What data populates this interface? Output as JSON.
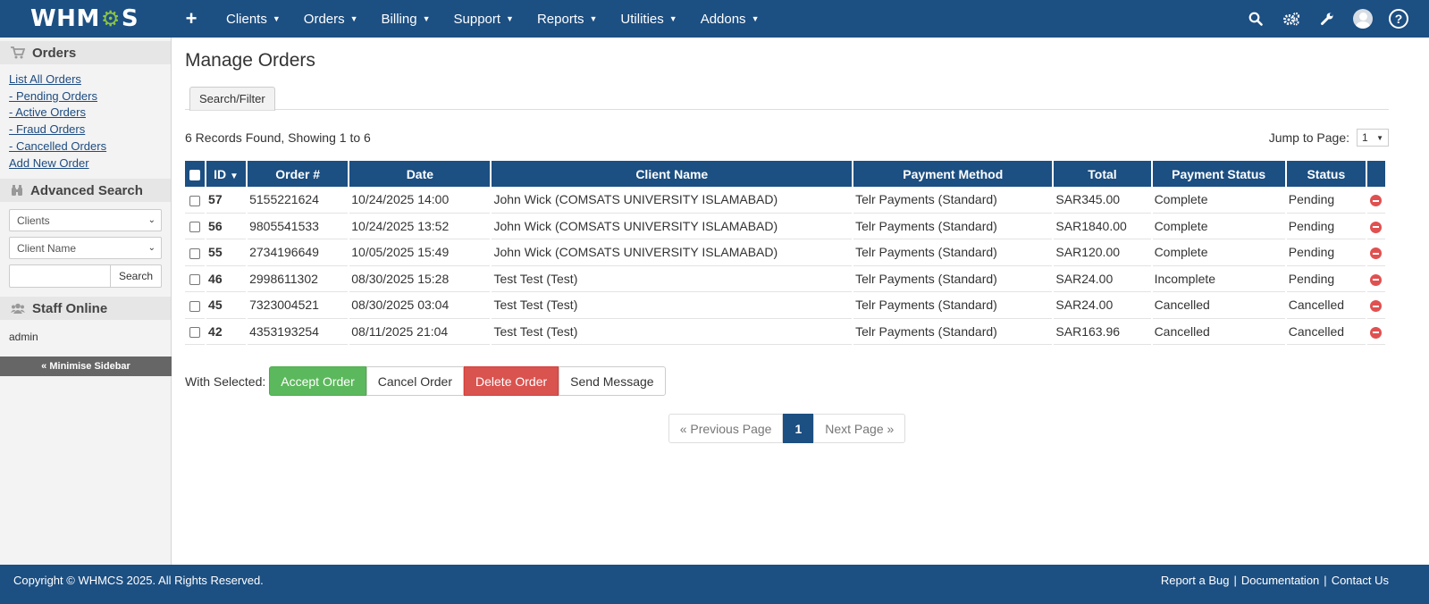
{
  "brand": {
    "logo_left": "WHM",
    "logo_right": "S"
  },
  "topnav": {
    "plus": "+",
    "items": [
      {
        "label": "Clients"
      },
      {
        "label": "Orders"
      },
      {
        "label": "Billing"
      },
      {
        "label": "Support"
      },
      {
        "label": "Reports"
      },
      {
        "label": "Utilities"
      },
      {
        "label": "Addons"
      }
    ],
    "right_icons": [
      "search-icon",
      "cogs-icon",
      "wrench-icon",
      "avatar",
      "help-icon"
    ],
    "help": "?"
  },
  "sidebar": {
    "orders_heading": "Orders",
    "links": [
      "List All Orders",
      "- Pending Orders",
      "- Active Orders",
      "- Fraud Orders",
      "- Cancelled Orders",
      "Add New Order"
    ],
    "adv_heading": "Advanced Search",
    "select1": "Clients",
    "select2": "Client Name",
    "search_button": "Search",
    "staff_heading": "Staff Online",
    "staff_user": "admin",
    "minimise": "« Minimise Sidebar"
  },
  "main": {
    "title": "Manage Orders",
    "tab": "Search/Filter",
    "records": "6 Records Found, Showing 1 to 6",
    "jump_label": "Jump to Page:",
    "jump_value": "1"
  },
  "table": {
    "headers": [
      "ID",
      "Order #",
      "Date",
      "Client Name",
      "Payment Method",
      "Total",
      "Payment Status",
      "Status"
    ],
    "sort_indicator": "▼",
    "rows": [
      {
        "id": "57",
        "order": "5155221624",
        "date": "10/24/2025 14:00",
        "client": "John Wick (COMSATS UNIVERSITY ISLAMABAD)",
        "method": "Telr Payments (Standard)",
        "total": "SAR345.00",
        "pay_status": "Complete",
        "status": "Pending"
      },
      {
        "id": "56",
        "order": "9805541533",
        "date": "10/24/2025 13:52",
        "client": "John Wick (COMSATS UNIVERSITY ISLAMABAD)",
        "method": "Telr Payments (Standard)",
        "total": "SAR1840.00",
        "pay_status": "Complete",
        "status": "Pending"
      },
      {
        "id": "55",
        "order": "2734196649",
        "date": "10/05/2025 15:49",
        "client": "John Wick (COMSATS UNIVERSITY ISLAMABAD)",
        "method": "Telr Payments (Standard)",
        "total": "SAR120.00",
        "pay_status": "Complete",
        "status": "Pending"
      },
      {
        "id": "46",
        "order": "2998611302",
        "date": "08/30/2025 15:28",
        "client": "Test Test (Test)",
        "method": "Telr Payments (Standard)",
        "total": "SAR24.00",
        "pay_status": "Incomplete",
        "status": "Pending"
      },
      {
        "id": "45",
        "order": "7323004521",
        "date": "08/30/2025 03:04",
        "client": "Test Test (Test)",
        "method": "Telr Payments (Standard)",
        "total": "SAR24.00",
        "pay_status": "Cancelled",
        "status": "Cancelled"
      },
      {
        "id": "42",
        "order": "4353193254",
        "date": "08/11/2025 21:04",
        "client": "Test Test (Test)",
        "method": "Telr Payments (Standard)",
        "total": "SAR163.96",
        "pay_status": "Cancelled",
        "status": "Cancelled"
      }
    ]
  },
  "actions": {
    "label": "With Selected:",
    "accept": "Accept Order",
    "cancel": "Cancel Order",
    "delete": "Delete Order",
    "send": "Send Message"
  },
  "pagination": {
    "prev": "« Previous Page",
    "current": "1",
    "next": "Next Page »"
  },
  "footer": {
    "copyright": "Copyright © WHMCS 2025. All Rights Reserved.",
    "links": [
      "Report a Bug",
      "Documentation",
      "Contact Us"
    ],
    "separator": "|"
  },
  "colors": {
    "primary": "#1c4f82",
    "complete": "#779500",
    "incomplete": "#cc0000",
    "cancelled": "#888888",
    "accept": "#5cb85c",
    "delete": "#d9534f"
  }
}
